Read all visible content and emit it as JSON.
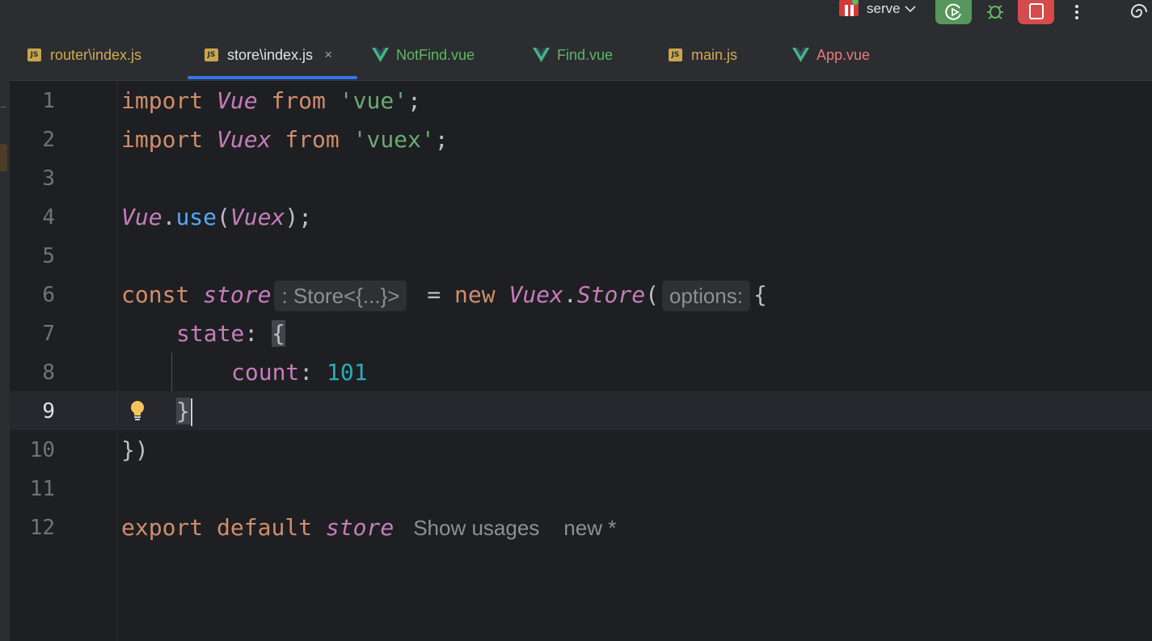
{
  "toolbar": {
    "run_config_label": "serve",
    "accent_run": "#57965c",
    "accent_stop": "#d54b4b"
  },
  "tabs": [
    {
      "label": "router\\index.js",
      "type": "js",
      "active": false
    },
    {
      "label": "store\\index.js",
      "type": "js",
      "active": true
    },
    {
      "label": "NotFind.vue",
      "type": "vue",
      "active": false
    },
    {
      "label": "Find.vue",
      "type": "vue",
      "active": false
    },
    {
      "label": "main.js",
      "type": "js",
      "active": false
    },
    {
      "label": "App.vue",
      "type": "vue",
      "active": false
    }
  ],
  "tab_badge": "JS",
  "tab_close": "×",
  "editor": {
    "line_numbers": [
      "1",
      "2",
      "3",
      "4",
      "5",
      "6",
      "7",
      "8",
      "9",
      "10",
      "11",
      "12"
    ],
    "current_line": 9,
    "line1": {
      "kw": "import",
      "id": "Vue",
      "from": "from",
      "str": "'vue'",
      "end": ";"
    },
    "line2": {
      "kw": "import",
      "id": "Vuex",
      "from": "from",
      "str": "'vuex'",
      "end": ";"
    },
    "line4": {
      "obj": "Vue",
      "dot": ".",
      "fn": "use",
      "open": "(",
      "arg": "Vuex",
      "close": ");"
    },
    "line6": {
      "kw": "const",
      "id": "store",
      "type_hint": ": Store<{...}>",
      "eq": " = ",
      "new": "new",
      "ns": "Vuex",
      "dot": ".",
      "cls": "Store",
      "open": "(",
      "param_hint": "options:",
      "brace": "{"
    },
    "line7": {
      "prop": "state",
      "colon": ": ",
      "brace": "{"
    },
    "line8": {
      "prop": "count",
      "colon": ": ",
      "num": "101"
    },
    "line9": {
      "brace": "}"
    },
    "line10": {
      "text": "})"
    },
    "line12": {
      "kw1": "export",
      "kw2": "default",
      "id": "store",
      "usages": "Show usages",
      "new_hint": "new *"
    }
  }
}
